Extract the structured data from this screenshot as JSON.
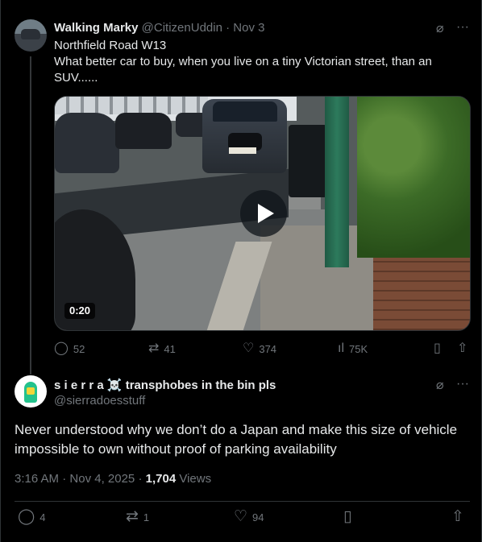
{
  "tweet1": {
    "name": "Walking Marky",
    "handle": "@CitizenUddin",
    "separator": "·",
    "date": "Nov 3",
    "line1": "Northfield Road W13",
    "line2": "What better car to buy, when you live on a tiny Victorian street, than an SUV......",
    "media": {
      "duration": "0:20",
      "plate_text": "BD18 SZL"
    },
    "stats": {
      "replies": "52",
      "reposts": "41",
      "likes": "374",
      "views": "75K"
    },
    "icons": {
      "grok": "grok-slash-icon",
      "more": "more-dots-icon",
      "reply": "reply-bubble-icon",
      "repost": "repost-arrows-icon",
      "like": "heart-icon",
      "views": "views-bars-icon",
      "bookmark": "bookmark-icon",
      "share": "share-up-icon"
    }
  },
  "tweet2": {
    "name": "s i e r r a ☠️ transphobes in the bin pls",
    "handle": "@sierradoesstuff",
    "text": "Never understood why we don’t do a Japan and make this size of vehicle impossible to own without proof of parking availability",
    "time": "3:16 AM",
    "date": "Nov 4, 2025",
    "views_count": "1,704",
    "views_label": "Views",
    "stats": {
      "replies": "4",
      "reposts": "1",
      "likes": "94"
    }
  },
  "colors": {
    "background": "#000000",
    "text": "#e7e9ea",
    "muted": "#71767b",
    "border": "#2f3336"
  }
}
